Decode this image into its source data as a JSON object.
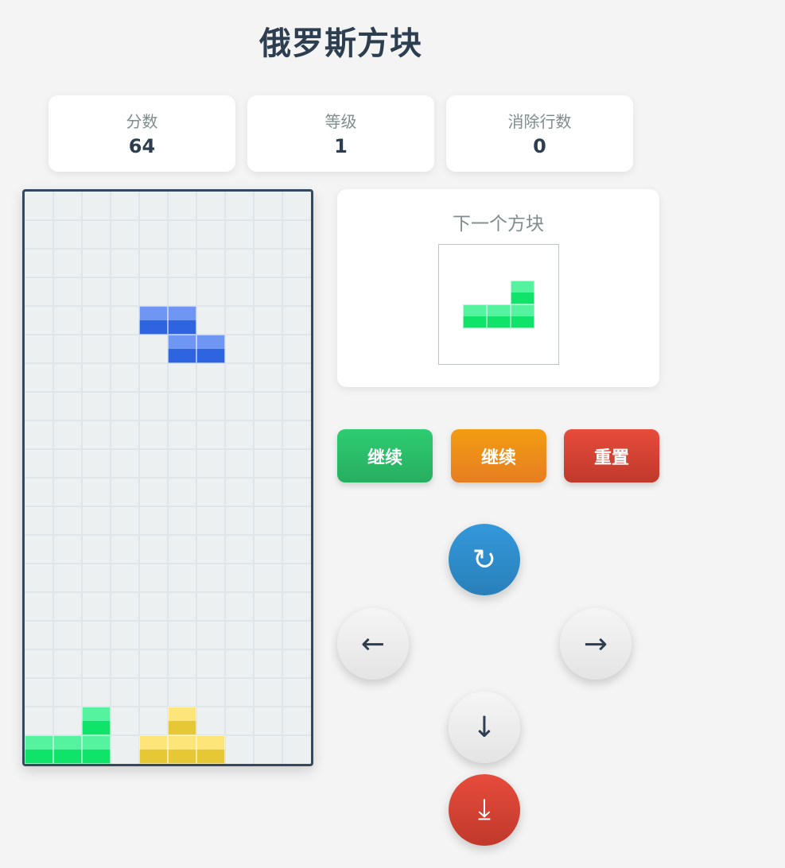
{
  "title": "俄罗斯方块",
  "stats": [
    {
      "label": "分数",
      "value": "64"
    },
    {
      "label": "等级",
      "value": "1"
    },
    {
      "label": "消除行数",
      "value": "0"
    }
  ],
  "next_label": "下一个方块",
  "buttons": {
    "resume_green": "继续",
    "resume_orange": "继续",
    "reset": "重置"
  },
  "controls": {
    "rotate": "↻",
    "left": "←",
    "right": "→",
    "down": "↓",
    "hard_drop": "⤓"
  },
  "board": {
    "cols": 10,
    "rows": 20,
    "grid_color": "#dfe6e9",
    "cells": [
      {
        "col": 4,
        "row": 4,
        "color": "blue"
      },
      {
        "col": 5,
        "row": 4,
        "color": "blue"
      },
      {
        "col": 5,
        "row": 5,
        "color": "blue"
      },
      {
        "col": 6,
        "row": 5,
        "color": "blue"
      },
      {
        "col": 2,
        "row": 18,
        "color": "green"
      },
      {
        "col": 0,
        "row": 19,
        "color": "green"
      },
      {
        "col": 1,
        "row": 19,
        "color": "green"
      },
      {
        "col": 2,
        "row": 19,
        "color": "green"
      },
      {
        "col": 5,
        "row": 18,
        "color": "yellow"
      },
      {
        "col": 4,
        "row": 19,
        "color": "yellow"
      },
      {
        "col": 5,
        "row": 19,
        "color": "yellow"
      },
      {
        "col": 6,
        "row": 19,
        "color": "yellow"
      }
    ]
  },
  "next_piece": {
    "color": "green",
    "cells": [
      {
        "col": 2,
        "row": 0
      },
      {
        "col": 0,
        "row": 1
      },
      {
        "col": 1,
        "row": 1
      },
      {
        "col": 2,
        "row": 1
      }
    ]
  },
  "palette": {
    "blue": {
      "top": "#6e96f2",
      "bottom": "#2f64e0"
    },
    "green": {
      "top": "#55f3a0",
      "bottom": "#0fe36a"
    },
    "yellow": {
      "top": "#fde57a",
      "bottom": "#e6c735"
    }
  }
}
